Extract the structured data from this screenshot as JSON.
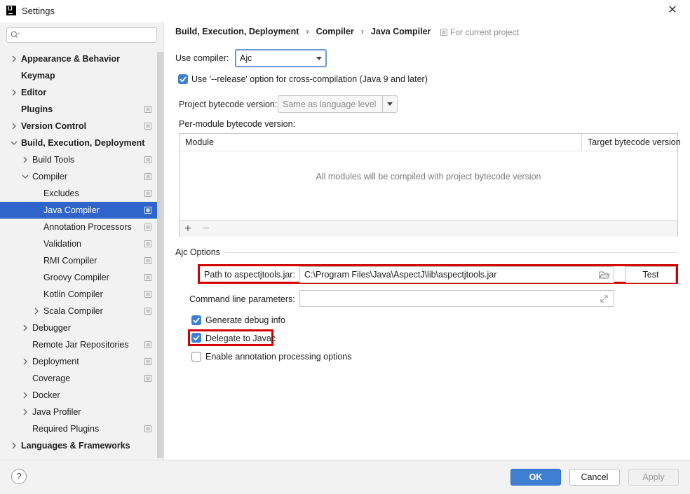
{
  "window": {
    "title": "Settings",
    "app_icon_text": "IJ"
  },
  "search": {
    "placeholder": ""
  },
  "sidebar": {
    "items": [
      {
        "label": "Appearance & Behavior"
      },
      {
        "label": "Keymap"
      },
      {
        "label": "Editor"
      },
      {
        "label": "Plugins"
      },
      {
        "label": "Version Control"
      },
      {
        "label": "Build, Execution, Deployment"
      },
      {
        "label": "Build Tools"
      },
      {
        "label": "Compiler"
      },
      {
        "label": "Excludes"
      },
      {
        "label": "Java Compiler"
      },
      {
        "label": "Annotation Processors"
      },
      {
        "label": "Validation"
      },
      {
        "label": "RMI Compiler"
      },
      {
        "label": "Groovy Compiler"
      },
      {
        "label": "Kotlin Compiler"
      },
      {
        "label": "Scala Compiler"
      },
      {
        "label": "Debugger"
      },
      {
        "label": "Remote Jar Repositories"
      },
      {
        "label": "Deployment"
      },
      {
        "label": "Coverage"
      },
      {
        "label": "Docker"
      },
      {
        "label": "Java Profiler"
      },
      {
        "label": "Required Plugins"
      },
      {
        "label": "Languages & Frameworks"
      }
    ],
    "selected": "Java Compiler"
  },
  "breadcrumb": {
    "parts": [
      "Build, Execution, Deployment",
      "Compiler",
      "Java Compiler"
    ],
    "separator": "›",
    "scope": "For current project"
  },
  "compiler": {
    "use_compiler_label": "Use compiler:",
    "use_compiler_value": "Ajc",
    "release_option_label": "Use '--release' option for cross-compilation (Java 9 and later)",
    "release_option_checked": true,
    "project_bytecode_label": "Project bytecode version:",
    "project_bytecode_value": "Same as language level",
    "per_module_label": "Per-module bytecode version:"
  },
  "module_table": {
    "columns": [
      "Module",
      "Target bytecode version"
    ],
    "empty_text": "All modules will be compiled with project bytecode version",
    "add_label": "+",
    "remove_label": "−"
  },
  "ajc": {
    "section_title": "Ajc Options",
    "path_label": "Path to aspectjtools.jar:",
    "path_value": "C:\\Program Files\\Java\\AspectJ\\lib\\aspectjtools.jar",
    "test_label": "Test",
    "cmd_label": "Command line parameters:",
    "cmd_value": "",
    "debug_info_label": "Generate debug info",
    "debug_info_checked": true,
    "delegate_label": "Delegate to Javac",
    "delegate_checked": true,
    "annotation_label": "Enable annotation processing options",
    "annotation_checked": false
  },
  "footer": {
    "help_label": "?",
    "ok_label": "OK",
    "cancel_label": "Cancel",
    "apply_label": "Apply"
  },
  "colors": {
    "accent": "#2f65ca",
    "highlight_box": "#d40000",
    "checkbox_on": "#3d7fd5"
  }
}
